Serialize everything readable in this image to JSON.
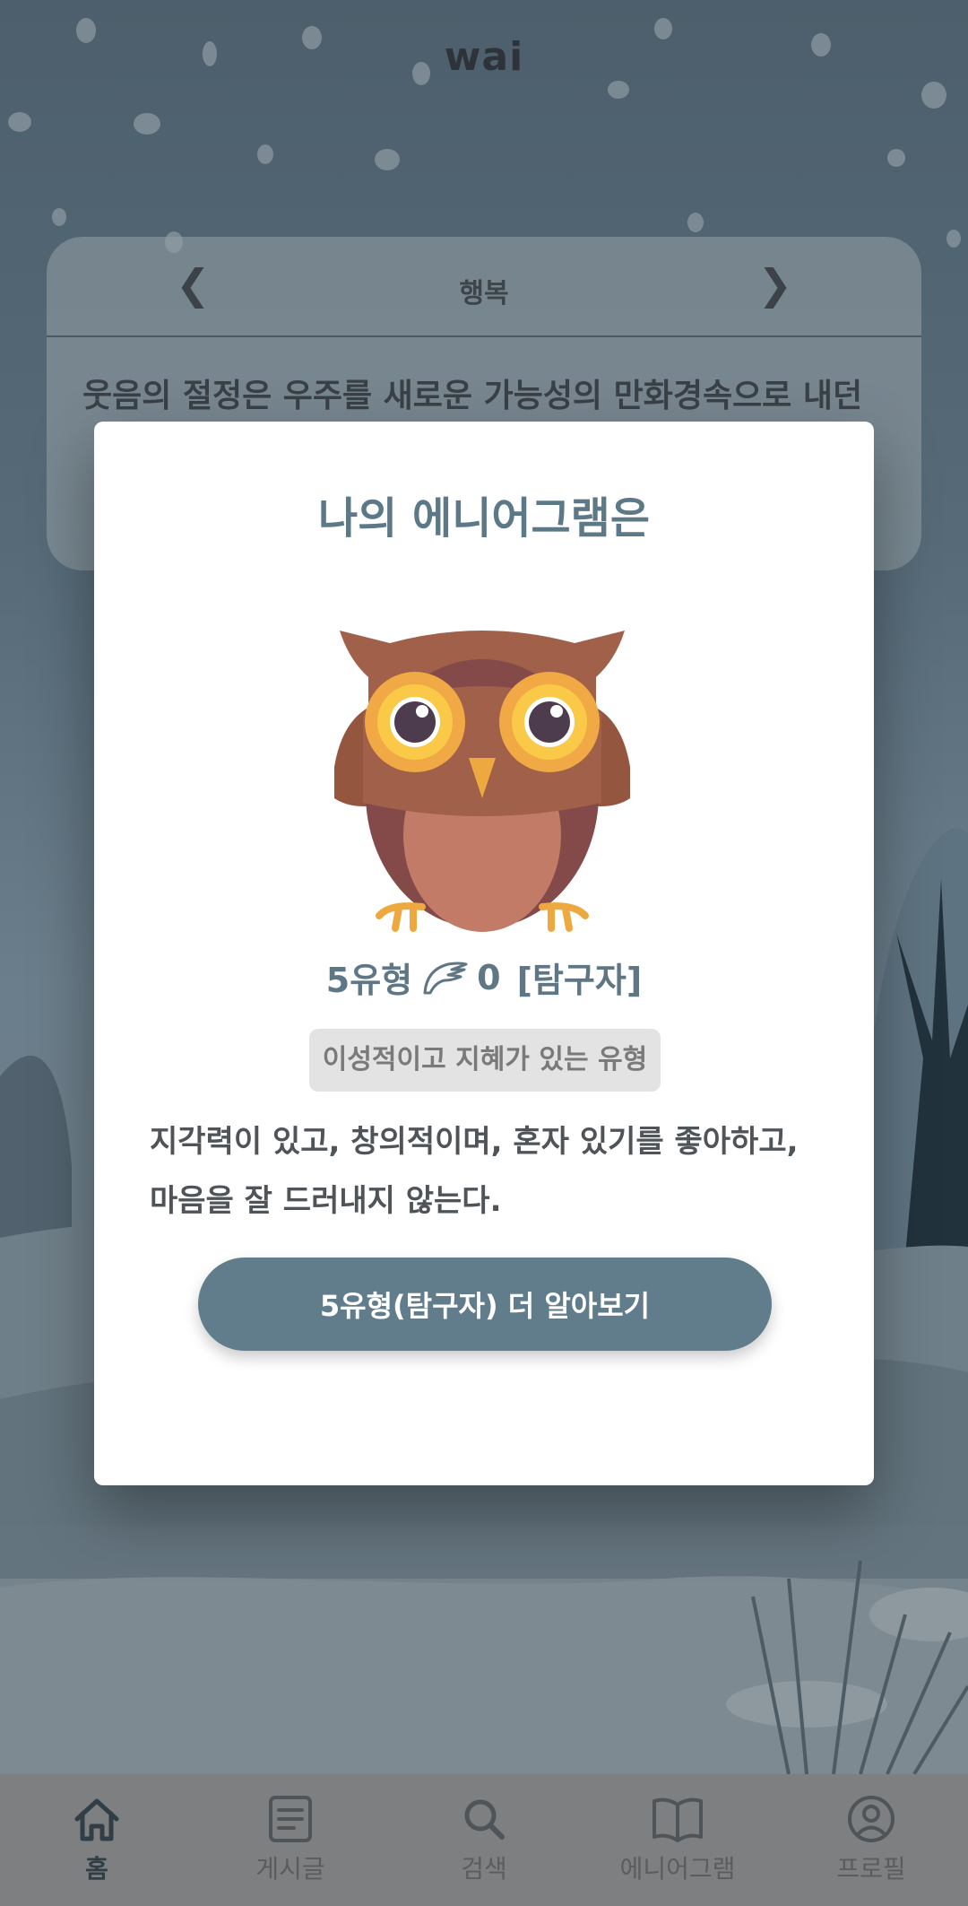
{
  "app": {
    "logo": "wai"
  },
  "quote_card": {
    "prev_icon": "chevron-left-icon",
    "next_icon": "chevron-right-icon",
    "category": "행복",
    "text": "웃음의 절정은 우주를 새로운 가능성의 만화경속으로 내던"
  },
  "modal": {
    "title": "나의 에니어그램은",
    "illustration": "owl-illustration",
    "type_number": "5유형",
    "wing_icon": "wing-icon",
    "wing_value": "0",
    "type_name": "[탐구자]",
    "tag": "이성적이고 지혜가 있는 유형",
    "description": "지각력이 있고, 창의적이며, 혼자 있기를 좋아하고, 마음을 잘 드러내지 않는다.",
    "button_label": "5유형(탐구자) 더 알아보기",
    "button_color": "#617d8b",
    "title_color": "#5d7886"
  },
  "nav": {
    "items": [
      {
        "label": "홈",
        "icon": "home-icon",
        "active": true
      },
      {
        "label": "게시글",
        "icon": "post-icon",
        "active": false
      },
      {
        "label": "검색",
        "icon": "search-icon",
        "active": false
      },
      {
        "label": "에니어그램",
        "icon": "book-icon",
        "active": false
      },
      {
        "label": "프로필",
        "icon": "profile-icon",
        "active": false
      }
    ]
  }
}
